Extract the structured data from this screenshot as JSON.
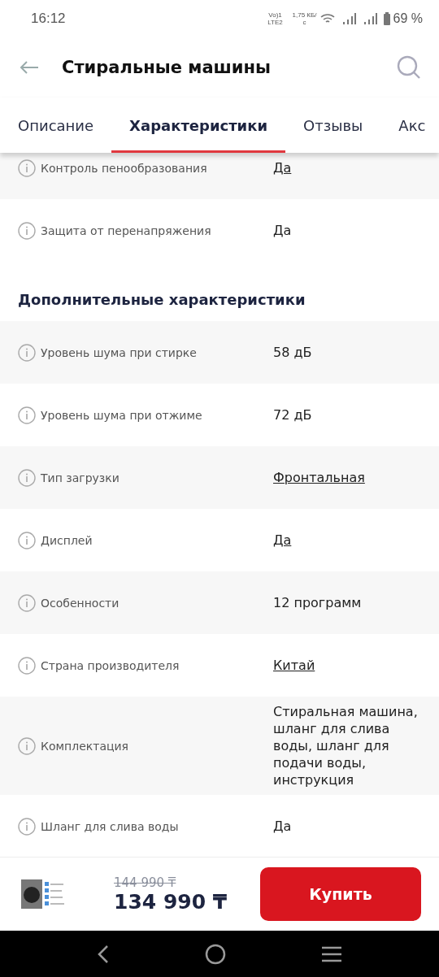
{
  "status_bar": {
    "time": "16:12",
    "network": "Vo)1 LTE2",
    "speed": "1,75 КБ/с",
    "battery": "69 %"
  },
  "header": {
    "title": "Стиральные машины"
  },
  "tabs": [
    {
      "label": "Описание",
      "selected": false
    },
    {
      "label": "Характеристики",
      "selected": true
    },
    {
      "label": "Отзывы",
      "selected": false
    },
    {
      "label": "Акс",
      "selected": false
    }
  ],
  "sections": [
    {
      "rows": [
        {
          "name": "Контроль пенообразования",
          "value": "Да",
          "link": true
        },
        {
          "name": "Защита от перенапряжения",
          "value": "Да",
          "link": false
        }
      ]
    },
    {
      "title": "Дополнительные характеристики",
      "rows": [
        {
          "name": "Уровень шума при стирке",
          "value": "58 дБ",
          "link": false
        },
        {
          "name": "Уровень шума при отжиме",
          "value": "72 дБ",
          "link": false
        },
        {
          "name": "Тип загрузки",
          "value": "Фронтальная",
          "link": true
        },
        {
          "name": "Дисплей",
          "value": "Да",
          "link": true
        },
        {
          "name": "Особенности",
          "value": "12 программ",
          "link": false
        },
        {
          "name": "Страна производителя",
          "value": "Китай",
          "link": true
        },
        {
          "name": "Комплектация",
          "value": "Стиральная машина, шланг для слива воды, шланг для подачи воды, инструкция",
          "link": false
        },
        {
          "name": "Шланг для слива воды",
          "value": "Да",
          "link": false
        }
      ]
    }
  ],
  "buy_bar": {
    "old_price": "144 990 ₸",
    "price": "134 990 ₸",
    "button": "Купить"
  }
}
